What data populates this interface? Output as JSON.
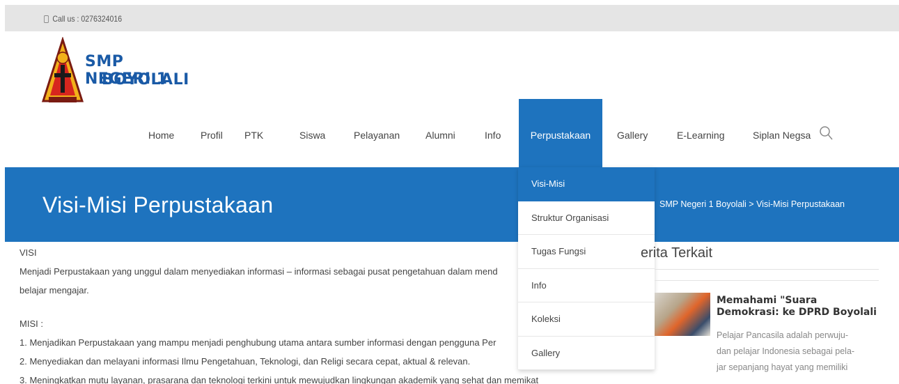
{
  "topbar": {
    "phone": "Call us : 0276324016"
  },
  "logo": {
    "line1": "SMP NEGERI 1",
    "line2": "BOYOLALI"
  },
  "nav": {
    "items": [
      "Home",
      "Profil",
      "PTK",
      "Siswa",
      "Pelayanan",
      "Alumni",
      "Info",
      "Perpustakaan",
      "Gallery",
      "E-Learning",
      "Siplan Negsa"
    ],
    "active": "Perpustakaan"
  },
  "hero": {
    "title": "Visi-Misi Perpustakaan",
    "breadcrumb": "SMP Negeri 1 Boyolali > Visi-Misi Perpustakaan"
  },
  "dropdown": {
    "items": [
      "Visi-Misi",
      "Struktur Organisasi",
      "Tugas Fungsi",
      "Info",
      "Koleksi",
      "Gallery"
    ]
  },
  "content": {
    "visi_heading": "VISI",
    "visi_line1": "Menjadi Perpustakaan yang unggul dalam menyediakan informasi – informasi sebagai pusat pengetahuan dalam mend",
    "visi_line2": "belajar mengajar.",
    "misi_heading": "MISI :",
    "misi_1": "1. Menjadikan Perpustakaan yang mampu menjadi penghubung utama antara sumber informasi dengan pengguna Per",
    "misi_2": "2. Menyediakan dan melayani informasi Ilmu Pengetahuan, Teknologi, dan Religi secara cepat, aktual & relevan.",
    "misi_3": "3. Meningkatkan mutu layanan, prasarana dan teknologi terkini untuk mewujudkan lingkungan akademik yang sehat dan memikat"
  },
  "sidebar": {
    "title": "erita Terkait",
    "post_title": "Memahami \"Suara Demokrasi: ke DPRD Boyolali",
    "excerpt_1": "Pelajar Pancasila adalah perwuju-",
    "excerpt_2": "dan pelajar Indonesia sebagai pela-",
    "excerpt_3": "jar sepanjang hayat yang memiliki"
  },
  "colors": {
    "primary": "#1e73be",
    "logo_text": "#1a5aa6",
    "topbar": "#e5e5e5"
  },
  "icons": {
    "phone": "phone-icon",
    "search": "search-icon",
    "logo": "school-emblem-icon"
  }
}
